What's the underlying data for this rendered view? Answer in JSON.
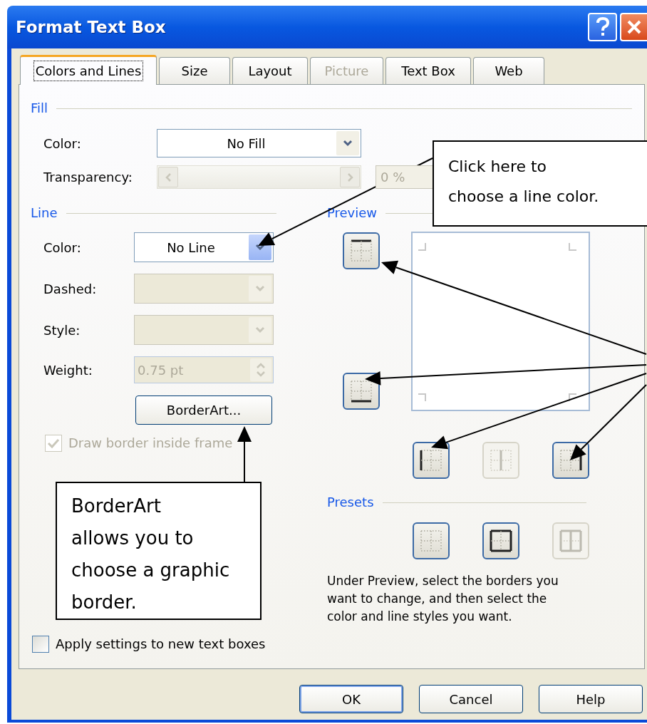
{
  "window": {
    "title": "Format Text Box"
  },
  "tabs": [
    {
      "label": "Colors and Lines",
      "selected": true,
      "disabled": false
    },
    {
      "label": "Size",
      "selected": false,
      "disabled": false
    },
    {
      "label": "Layout",
      "selected": false,
      "disabled": false
    },
    {
      "label": "Picture",
      "selected": false,
      "disabled": true
    },
    {
      "label": "Text Box",
      "selected": false,
      "disabled": false
    },
    {
      "label": "Web",
      "selected": false,
      "disabled": false
    }
  ],
  "fill": {
    "heading": "Fill",
    "color": {
      "label": "Color:",
      "value": "No Fill"
    },
    "transparency": {
      "label": "Transparency:",
      "value": "0 %",
      "disabled": true
    }
  },
  "line": {
    "heading": "Line",
    "fields": [
      {
        "kind": "dropdown",
        "label": "Color:",
        "value": "No Line",
        "disabled": false
      },
      {
        "kind": "dropdown",
        "label": "Dashed:",
        "disabled": true
      },
      {
        "kind": "dropdown",
        "label": "Style:",
        "disabled": true
      },
      {
        "kind": "spinner",
        "label": "Weight:",
        "value": "0.75 pt",
        "disabled": true
      }
    ],
    "borderart_button": "BorderArt...",
    "draw_inside": {
      "label": "Draw border inside frame",
      "checked": true,
      "disabled": true
    }
  },
  "preview": {
    "heading": "Preview",
    "side_buttons": [
      {
        "kind": "top",
        "disabled": false
      },
      {
        "kind": "bottom",
        "disabled": false
      }
    ],
    "bottom_buttons": [
      {
        "kind": "left",
        "disabled": false
      },
      {
        "kind": "center",
        "disabled": true
      },
      {
        "kind": "right",
        "disabled": false
      }
    ]
  },
  "presets": {
    "heading": "Presets",
    "items": [
      {
        "kind": "none",
        "disabled": false
      },
      {
        "kind": "box",
        "disabled": false
      },
      {
        "kind": "grid",
        "disabled": true
      }
    ],
    "description": "Under Preview, select the borders you want to change, and then select the color and line styles you want."
  },
  "apply_checkbox": {
    "label": "Apply settings to new text boxes",
    "checked": false
  },
  "buttons": [
    {
      "label": "OK",
      "default": true
    },
    {
      "label": "Cancel",
      "default": false
    },
    {
      "label": "Help",
      "default": false
    }
  ],
  "callouts": [
    {
      "text": "Click here to\nchoose a line color."
    },
    {
      "text": "BorderArt\nallows you to\nchoose a graphic\nborder."
    }
  ]
}
